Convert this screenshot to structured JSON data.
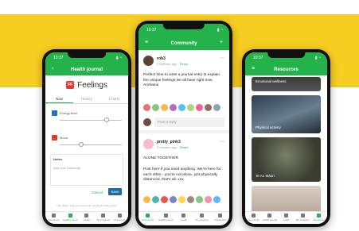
{
  "left_phone": {
    "status_time": "10:37",
    "appbar_title": "Health journal",
    "logo_text": "FF",
    "title": "Feelings",
    "tabs": [
      "Now",
      "History",
      "Charts"
    ],
    "slider1_label": "Energy level",
    "slider2_label": "Mood",
    "notes_label": "Notes",
    "notes_placeholder": "Add note (optional)",
    "cancel_label": "Cancel",
    "save_label": "Save",
    "notice": "Your \"Entry\" is for your eyes only, not shared with anyone"
  },
  "center_phone": {
    "status_time": "10:37",
    "appbar_title": "Community",
    "posts": [
      {
        "user": "rob3",
        "meta": "2 minutes ago",
        "react": "React",
        "body": "Perfect time to write a journal entry to explain the unique feelings we all have right now. Arohanui"
      },
      {
        "user": "pretty_pink3",
        "meta": "5 minutes ago",
        "react": "React",
        "body_title": "ALONE TOGETHER",
        "body": "Post here if you need anything. We're here for each other - you're not alone, just physically distanced, that's all. xox"
      }
    ],
    "reply_placeholder": "Post a reply"
  },
  "right_phone": {
    "status_time": "10:37",
    "appbar_title": "Resources",
    "cards": [
      "Emotional wellness",
      "Physical activity",
      "Te Ao Māori",
      ""
    ]
  },
  "bottom_nav": [
    "Community",
    "Health journal",
    "Goals",
    "My progress",
    "Resources"
  ],
  "colors": {
    "brand_green": "#24b34b",
    "band_yellow": "#f6cd21",
    "save_blue": "#1d6aa5"
  }
}
